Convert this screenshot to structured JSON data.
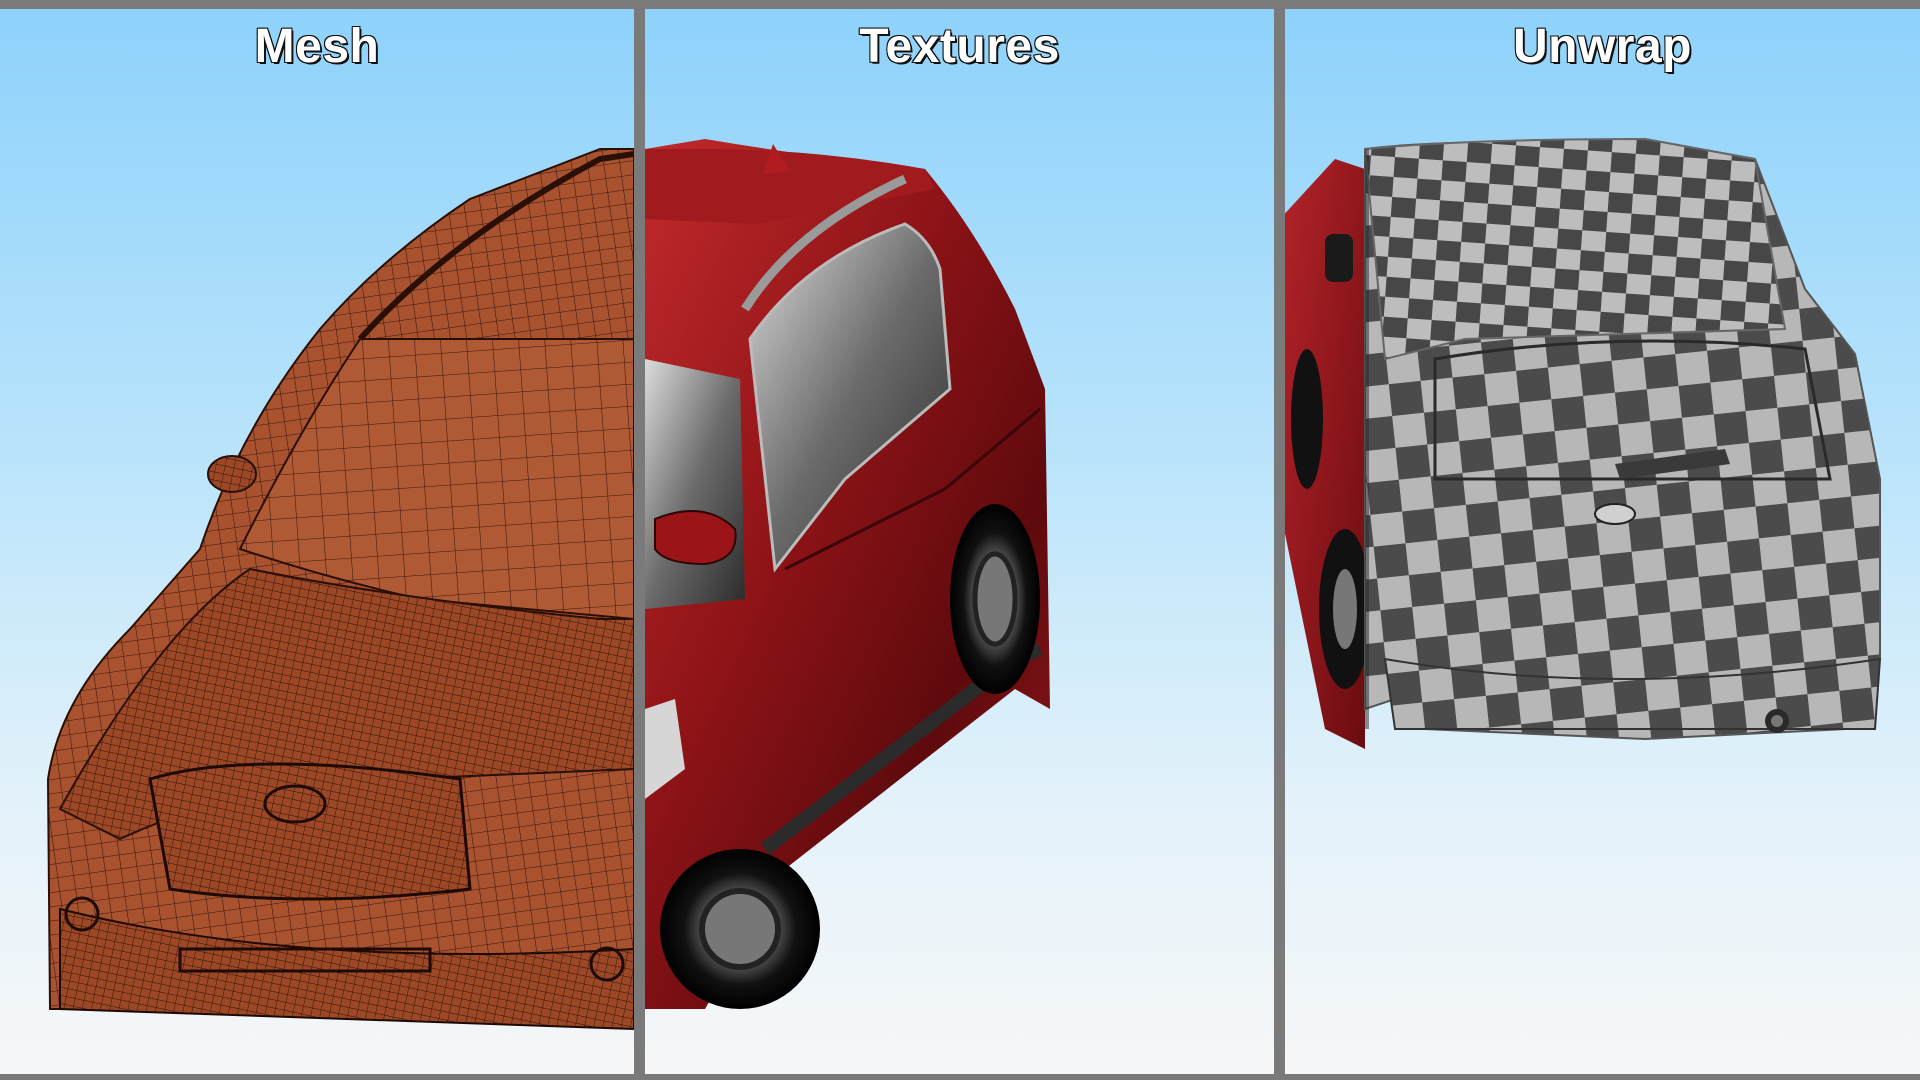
{
  "panels": [
    {
      "id": "mesh",
      "title": "Mesh"
    },
    {
      "id": "textures",
      "title": "Textures"
    },
    {
      "id": "unwrap",
      "title": "Unwrap"
    }
  ],
  "colors": {
    "frame": "#7a7a7a",
    "sky_top": "#8ed2fb",
    "sky_bottom": "#f6f7f8",
    "mesh_fill": "#a8502f",
    "mesh_line": "#3a160b",
    "paint_red": "#8c1216",
    "checker_dark": "#4a4a4a",
    "checker_light": "#b5b5b5"
  },
  "icons": [
    "wireframe-car-image",
    "textured-car-image",
    "checker-uv-car-image"
  ]
}
